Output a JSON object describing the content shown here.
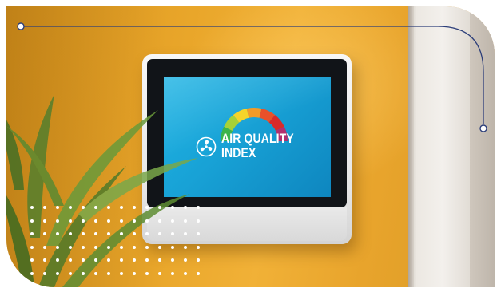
{
  "screen": {
    "title_line1": "AIR QUALITY",
    "title_line2": "INDEX",
    "icon": "fan-icon",
    "gauge_colors": [
      "#3cb44b",
      "#a6d138",
      "#f4d42a",
      "#f29b27",
      "#e8512a",
      "#d92a2a",
      "#b1306e"
    ]
  },
  "colors": {
    "wall": "#e9a62a",
    "screen": "#18a2d6",
    "accent_line": "#2d3f7a"
  }
}
